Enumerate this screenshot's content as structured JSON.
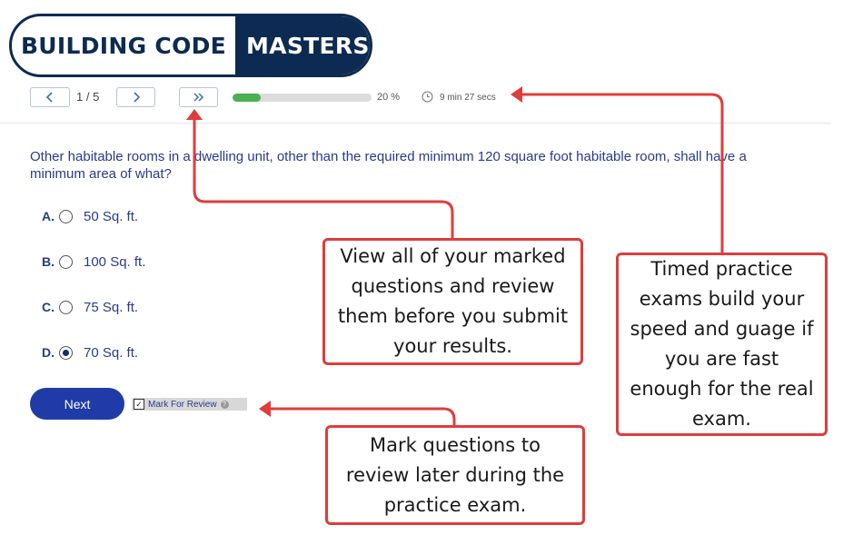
{
  "logo": {
    "left": "BUILDING CODE",
    "right": "MASTERS"
  },
  "toolbar": {
    "prev_icon": "chevron-left-icon",
    "page_counter": "1 / 5",
    "next_icon": "chevron-right-icon",
    "review_icon": "double-chevron-right-icon",
    "progress_percent": 20,
    "progress_text": "20 %",
    "timer_icon": "clock-icon",
    "timer_text": "9 min 27 secs"
  },
  "question": {
    "text": "Other habitable rooms in a dwelling unit, other than the required minimum 120 square foot habitable room, shall have a minimum area of what?",
    "options": [
      {
        "letter": "A.",
        "text": "50 Sq. ft.",
        "selected": false
      },
      {
        "letter": "B.",
        "text": "100 Sq. ft.",
        "selected": false
      },
      {
        "letter": "C.",
        "text": "75 Sq. ft.",
        "selected": false
      },
      {
        "letter": "D.",
        "text": "70 Sq. ft.",
        "selected": true
      }
    ]
  },
  "actions": {
    "next_label": "Next",
    "mark_review_label": "Mark For Review",
    "mark_review_checked": true,
    "help_label": "?"
  },
  "callouts": {
    "review": [
      "View all of your marked",
      "questions and review",
      "them before you submit",
      "your results."
    ],
    "timed": [
      "Timed practice",
      "exams build your",
      "speed and guage if",
      "you are fast",
      "enough for the real",
      "exam."
    ],
    "mark": [
      "Mark questions to",
      "review later during the",
      "practice exam."
    ]
  },
  "colors": {
    "brand_navy": "#0d2b52",
    "accent_blue": "#1f3ba8",
    "callout_red": "#e03c3c",
    "progress_green": "#4caf50"
  }
}
